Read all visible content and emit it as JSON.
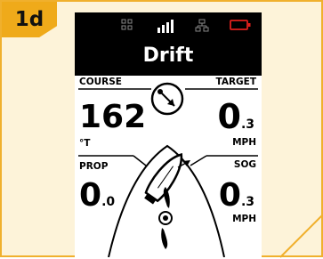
{
  "step": {
    "label": "1d"
  },
  "status_bar": {
    "icons": [
      "gps-icon",
      "signal-icon",
      "network-icon",
      "battery-icon"
    ]
  },
  "mode": {
    "title": "Drift"
  },
  "course": {
    "label": "COURSE",
    "value": "162",
    "unit": "°T"
  },
  "target": {
    "label": "TARGET",
    "value_int": "0",
    "value_dec": ".3",
    "unit": "MPH"
  },
  "prop": {
    "label": "PROP",
    "value_int": "0",
    "value_dec": ".0"
  },
  "sog": {
    "label": "SOG",
    "value_int": "0",
    "value_dec": ".3",
    "unit": "MPH"
  },
  "colors": {
    "accent": "#efaa1a",
    "frame_bg": "#fdf3d9",
    "battery": "#e0201c"
  }
}
